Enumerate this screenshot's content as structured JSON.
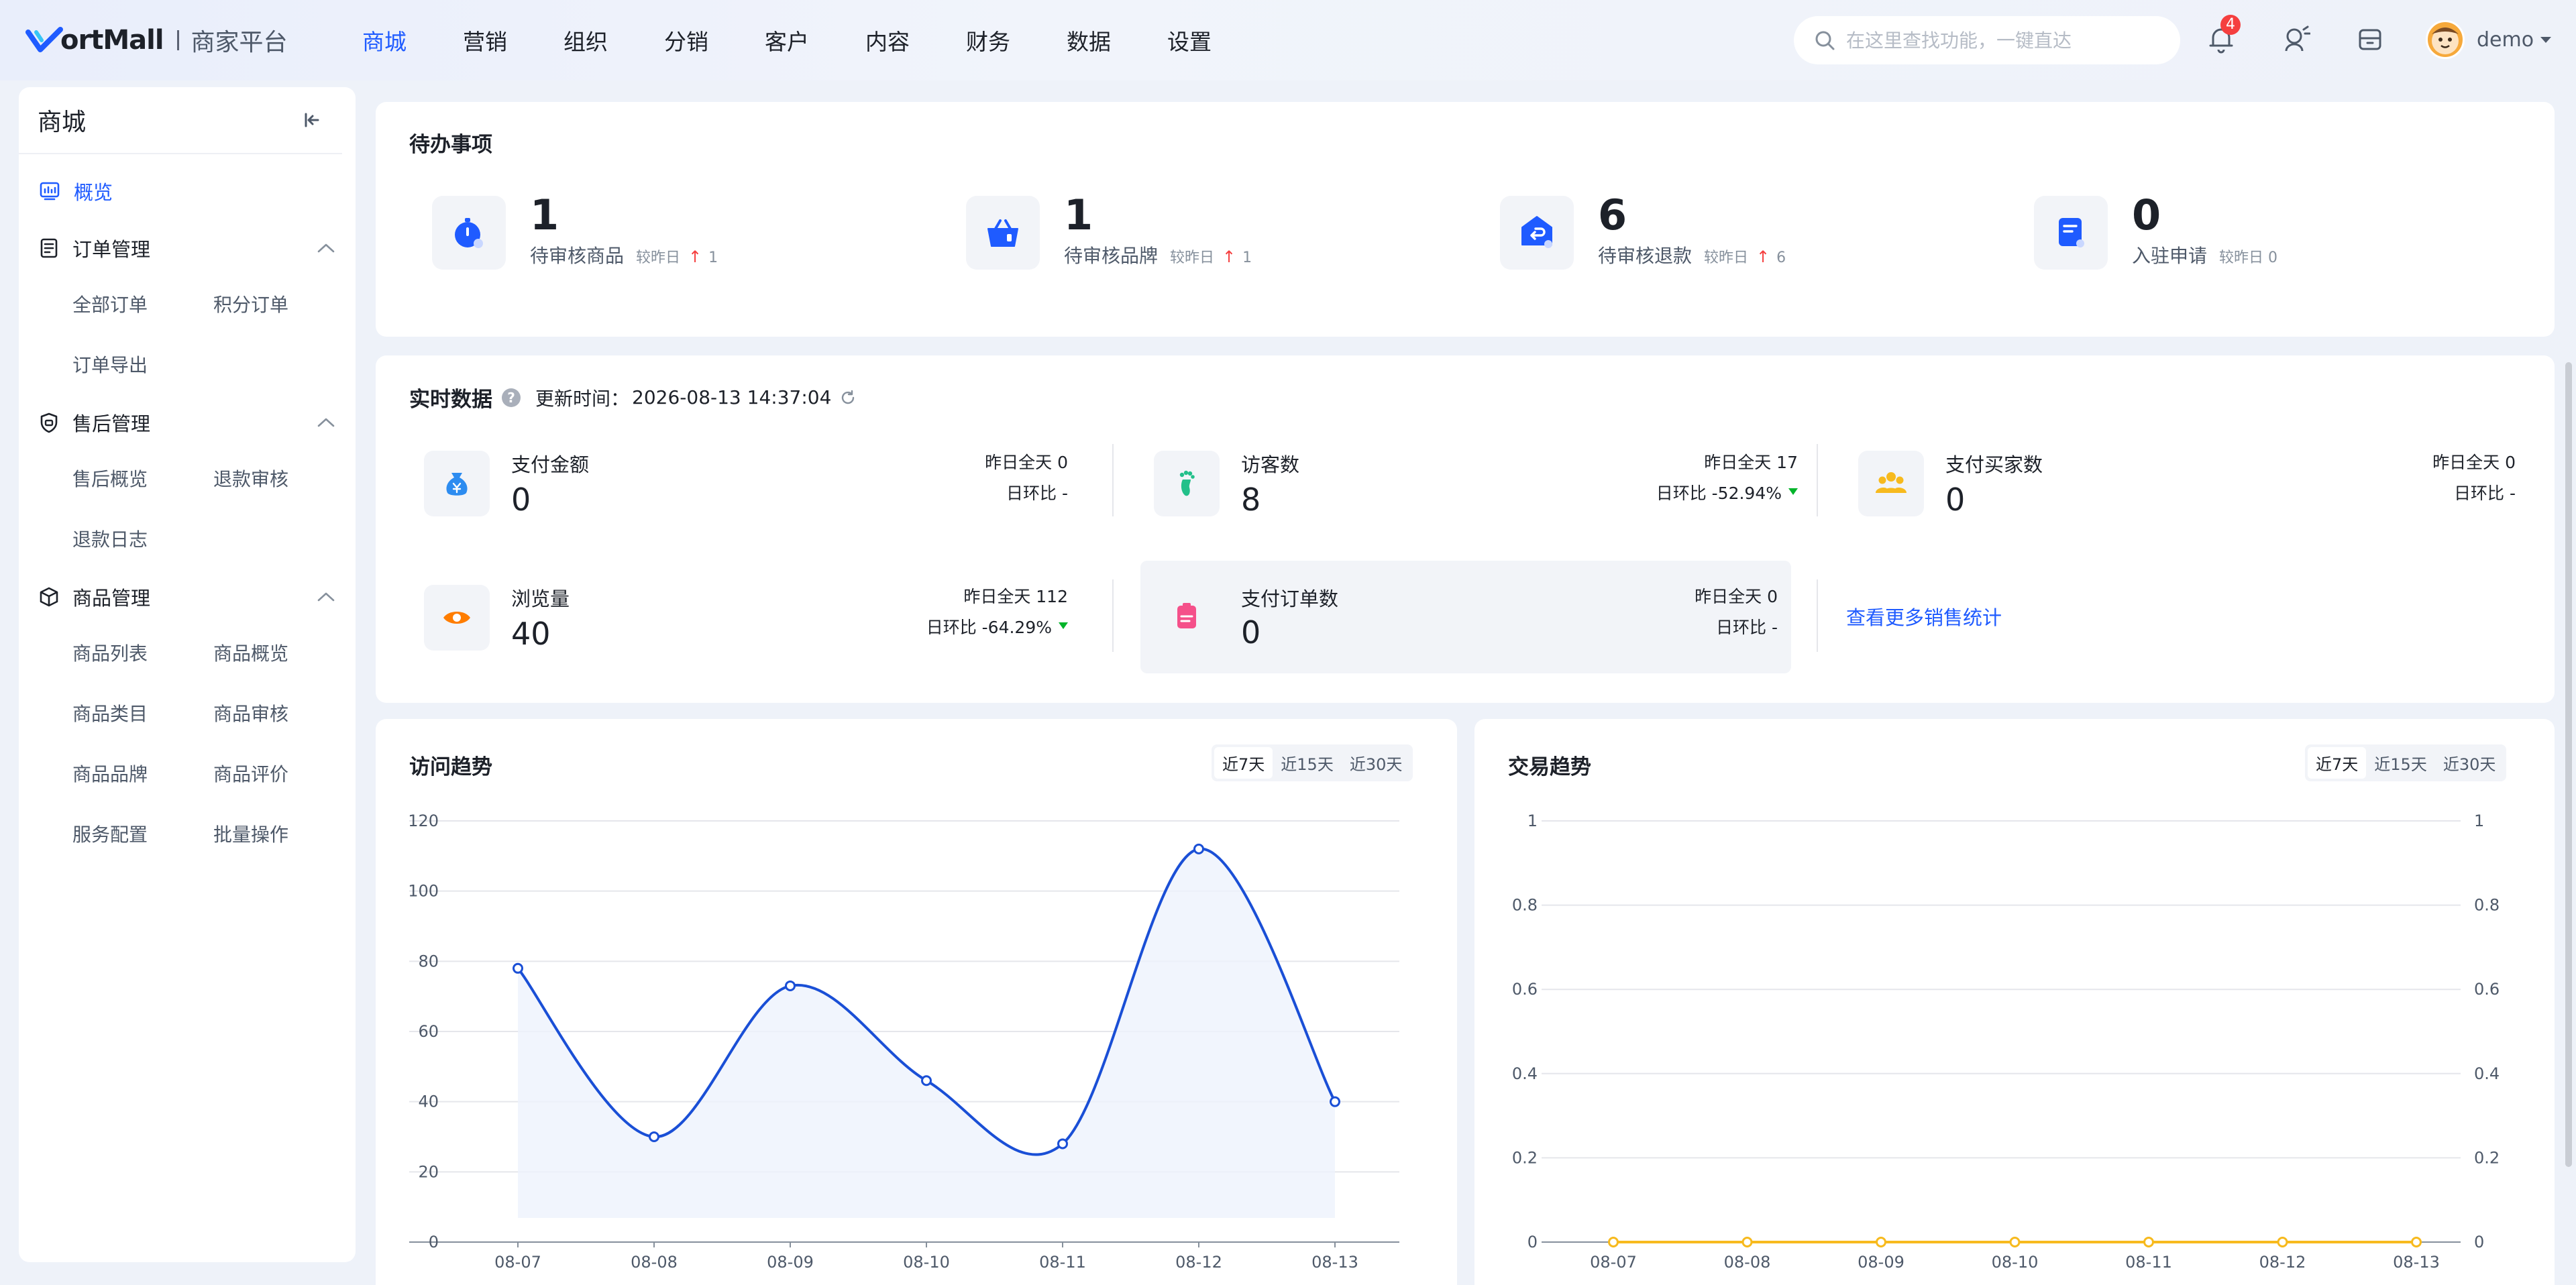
{
  "brand": {
    "name": "ortMall",
    "sub": "商家平台"
  },
  "topnav": [
    "商城",
    "营销",
    "组织",
    "分销",
    "客户",
    "内容",
    "财务",
    "数据",
    "设置"
  ],
  "search": {
    "placeholder": "在这里查找功能，一键直达"
  },
  "header": {
    "notification_count": "4",
    "username": "demo"
  },
  "sidebar": {
    "title": "商城",
    "overview": "概览",
    "groups": [
      {
        "label": "订单管理",
        "items": [
          "全部订单",
          "积分订单",
          "订单导出"
        ]
      },
      {
        "label": "售后管理",
        "items": [
          "售后概览",
          "退款审核",
          "退款日志"
        ]
      },
      {
        "label": "商品管理",
        "items": [
          "商品列表",
          "商品概览",
          "商品类目",
          "商品审核",
          "商品品牌",
          "商品评价",
          "服务配置",
          "批量操作"
        ]
      }
    ]
  },
  "todo": {
    "title": "待办事项",
    "items": [
      {
        "num": "1",
        "label": "待审核商品",
        "cmp": "较昨日",
        "up": "↑",
        "delta": "1"
      },
      {
        "num": "1",
        "label": "待审核品牌",
        "cmp": "较昨日",
        "up": "↑",
        "delta": "1"
      },
      {
        "num": "6",
        "label": "待审核退款",
        "cmp": "较昨日",
        "up": "↑",
        "delta": "6"
      },
      {
        "num": "0",
        "label": "入驻申请",
        "cmp": "较昨日 0",
        "up": "",
        "delta": ""
      }
    ]
  },
  "realtime": {
    "title": "实时数据",
    "help": "?",
    "update_label": "更新时间：",
    "update_time": "2026-08-13 14:37:04",
    "metrics": [
      {
        "label": "支付金额",
        "value": "0",
        "yday": "昨日全天  0",
        "ratio": "日环比   -"
      },
      {
        "label": "访客数",
        "value": "8",
        "yday": "昨日全天  17",
        "ratio": "日环比  -52.94%"
      },
      {
        "label": "支付买家数",
        "value": "0",
        "yday": "昨日全天  0",
        "ratio": "日环比   -"
      },
      {
        "label": "浏览量",
        "value": "40",
        "yday": "昨日全天  112",
        "ratio": "日环比  -64.29%"
      },
      {
        "label": "支付订单数",
        "value": "0",
        "yday": "昨日全天  0",
        "ratio": "日环比   -"
      }
    ],
    "more_link": "查看更多销售统计"
  },
  "ranges": [
    "近7天",
    "近15天",
    "近30天"
  ],
  "colors": {
    "accent": "#1f5bff",
    "up": "#f53f3f",
    "down": "#00b42a",
    "visit_line": "#1a4fd6",
    "trade_line": "#f7ba1e"
  },
  "chart_data": [
    {
      "type": "line",
      "title": "访问趋势",
      "categories": [
        "08-07",
        "08-08",
        "08-09",
        "08-10",
        "08-11",
        "08-12",
        "08-13"
      ],
      "series": [
        {
          "values": [
            78,
            30,
            73,
            46,
            28,
            112,
            40
          ]
        }
      ],
      "ylim": [
        0,
        120
      ],
      "yticks": [
        "0",
        "20",
        "40",
        "60",
        "80",
        "100",
        "120"
      ],
      "grid": true,
      "area": true
    },
    {
      "type": "line",
      "title": "交易趋势",
      "categories": [
        "08-07",
        "08-08",
        "08-09",
        "08-10",
        "08-11",
        "08-12",
        "08-13"
      ],
      "series": [
        {
          "values": [
            0,
            0,
            0,
            0,
            0,
            0,
            0
          ]
        }
      ],
      "ylim": [
        0,
        1
      ],
      "yticks": [
        "0",
        "0.2",
        "0.4",
        "0.6",
        "0.8",
        "1"
      ],
      "grid": true,
      "dual_axis": true
    }
  ]
}
